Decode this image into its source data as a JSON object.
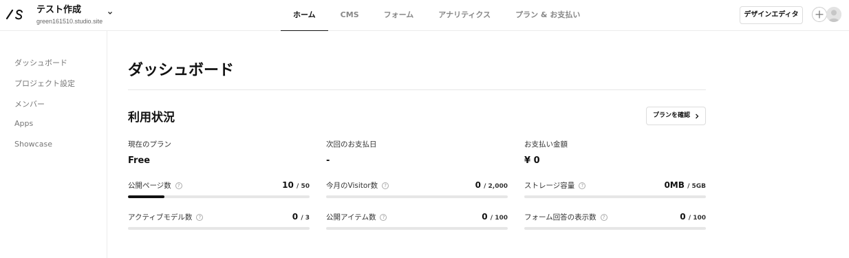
{
  "header": {
    "project_name": "テスト作成",
    "project_url": "green161510.studio.site",
    "nav": [
      {
        "label": "ホーム",
        "active": true
      },
      {
        "label": "CMS",
        "active": false
      },
      {
        "label": "フォーム",
        "active": false
      },
      {
        "label": "アナリティクス",
        "active": false
      },
      {
        "label": "プラン & お支払い",
        "active": false
      }
    ],
    "design_editor_label": "デザインエディタ"
  },
  "sidebar": {
    "items": [
      {
        "label": "ダッシュボード"
      },
      {
        "label": "プロジェクト設定"
      },
      {
        "label": "メンバー"
      },
      {
        "label": "Apps"
      },
      {
        "label": "Showcase"
      }
    ]
  },
  "main": {
    "title": "ダッシュボード",
    "usage_title": "利用状況",
    "check_plan_label": "プランを確認",
    "info": [
      {
        "label": "現在のプラン",
        "value": "Free"
      },
      {
        "label": "次回のお支払日",
        "value": "-"
      },
      {
        "label": "お支払い金額",
        "value": "¥ 0"
      }
    ],
    "metrics": [
      {
        "label": "公開ページ数",
        "value": "10",
        "total": "/ 50",
        "fraction": 0.2
      },
      {
        "label": "今月のVisitor数",
        "value": "0",
        "total": "/ 2,000",
        "fraction": 0
      },
      {
        "label": "ストレージ容量",
        "value": "0MB",
        "total": "/ 5GB",
        "fraction": 0
      },
      {
        "label": "アクティブモデル数",
        "value": "0",
        "total": "/ 3",
        "fraction": 0
      },
      {
        "label": "公開アイテム数",
        "value": "0",
        "total": "/ 100",
        "fraction": 0
      },
      {
        "label": "フォーム回答の表示数",
        "value": "0",
        "total": "/ 100",
        "fraction": 0
      }
    ],
    "help_glyph": "?"
  },
  "colors": {
    "accent": "#111111",
    "muted_text": "#888888",
    "border": "#ececec",
    "bar_track": "#e6e6e6"
  },
  "icons": {
    "logo": "studio-logo-icon",
    "chevron": "chevron-down-icon",
    "plus": "plus-icon",
    "avatar": "user-avatar-icon",
    "arrow": "chevron-right-icon",
    "help": "help-circle-icon"
  }
}
